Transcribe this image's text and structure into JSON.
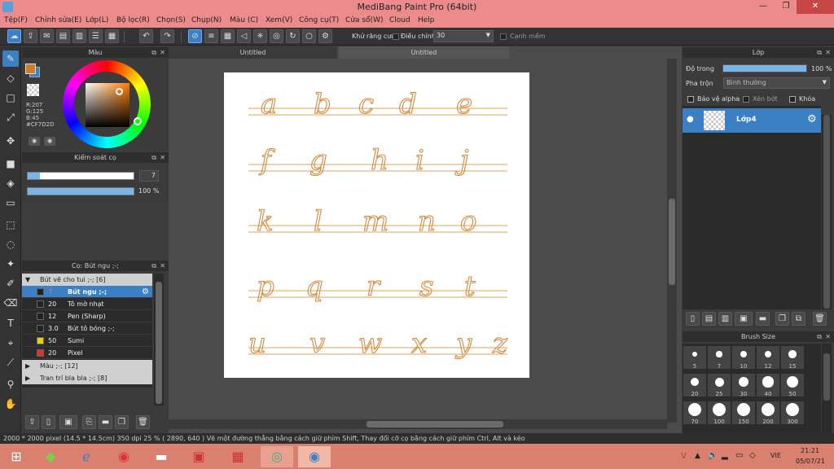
{
  "window": {
    "title": "MediBang Paint Pro (64bit)",
    "min": "—",
    "max": "❐",
    "close": "✕"
  },
  "menu": [
    "Tệp(F)",
    "Chỉnh sửa(E)",
    "Lớp(L)",
    "Bộ lọc(R)",
    "Chọn(S)",
    "Chụp(N)",
    "Màu (C)",
    "Xem(V)",
    "Công cụ(T)",
    "Cửa sổ(W)",
    "Cloud",
    "Help"
  ],
  "toolbar": {
    "antialias_label": "Khử răng cưa",
    "adjust_label": "Điều chỉnh",
    "adjust_value": "30",
    "soft_edge_label": "Cạnh mềm"
  },
  "color_panel": {
    "title": "Màu",
    "r": "R:207",
    "g": "G:125",
    "b": "B:45",
    "hex": "#CF7D2D",
    "fg_color": "#cf7d2d",
    "bg_color": "#3b7fc4"
  },
  "brush_control": {
    "title": "Kiểm soát cọ",
    "size_value": "7",
    "opacity_value": "100 %"
  },
  "brush_list": {
    "title": "Cọ: Bút ngu ;-;",
    "group1": "Bút vẽ cho tui ;-; [6]",
    "items": [
      {
        "size": "7",
        "name": "Bút ngu ;-;",
        "color": "#222222",
        "sel": true
      },
      {
        "size": "20",
        "name": "Tô mờ nhạt",
        "color": "#222222",
        "sel": false
      },
      {
        "size": "12",
        "name": "Pen (Sharp)",
        "color": "#222222",
        "sel": false
      },
      {
        "size": "3.0",
        "name": "Bút tô bóng ;-;",
        "color": "#222222",
        "sel": false
      },
      {
        "size": "50",
        "name": "Sumi",
        "color": "#f0d000",
        "sel": false
      },
      {
        "size": "20",
        "name": "Pixel",
        "color": "#e03030",
        "sel": false
      }
    ],
    "group2": "Màu ;-; [12]",
    "group3": "Tran trí bla bla ;-; [8]"
  },
  "tabs": [
    "Untitled",
    "Untitled"
  ],
  "canvas_rows": [
    {
      "letters": [
        "a",
        "b",
        "c",
        "d",
        "e"
      ]
    },
    {
      "letters": [
        "f",
        "g",
        "h",
        "i",
        "j"
      ]
    },
    {
      "letters": [
        "k",
        "l",
        "m",
        "n",
        "o"
      ]
    },
    {
      "letters": [
        "p",
        "q",
        "r",
        "s",
        "t"
      ]
    },
    {
      "letters": [
        "u",
        "v",
        "w",
        "x",
        "y",
        "z"
      ]
    }
  ],
  "layer_panel": {
    "title": "Lớp",
    "opacity_label": "Độ trong",
    "opacity_value": "100 %",
    "opacity_fraction": 1.0,
    "blend_label": "Pha trộn",
    "blend_value": "Bình thường",
    "protect_alpha": "Bảo vệ alpha",
    "clip": "Xén bớt",
    "lock": "Khóa",
    "layer_name": "Lớp4"
  },
  "brush_size_panel": {
    "title": "Brush Size",
    "sizes": [
      "5",
      "7",
      "10",
      "12",
      "15",
      "20",
      "25",
      "30",
      "40",
      "50",
      "70",
      "100",
      "150",
      "200",
      "300"
    ]
  },
  "status": {
    "text": "2000 * 2000 pixel   (14.5 * 14.5cm)   350 dpi   25 %   ( 2890, 640 )   Vẽ một đường thẳng bằng cách giữ phím Shift, Thay đổi cỡ cọ bằng cách giữ phím Ctrl, Alt và kéo"
  },
  "taskbar": {
    "lang": "VIE",
    "time": "21:21",
    "date": "05/07/21"
  },
  "colors": {
    "stroke": "#d68a3c",
    "guide": "#e0a060",
    "accent": "#3b7fc4"
  }
}
